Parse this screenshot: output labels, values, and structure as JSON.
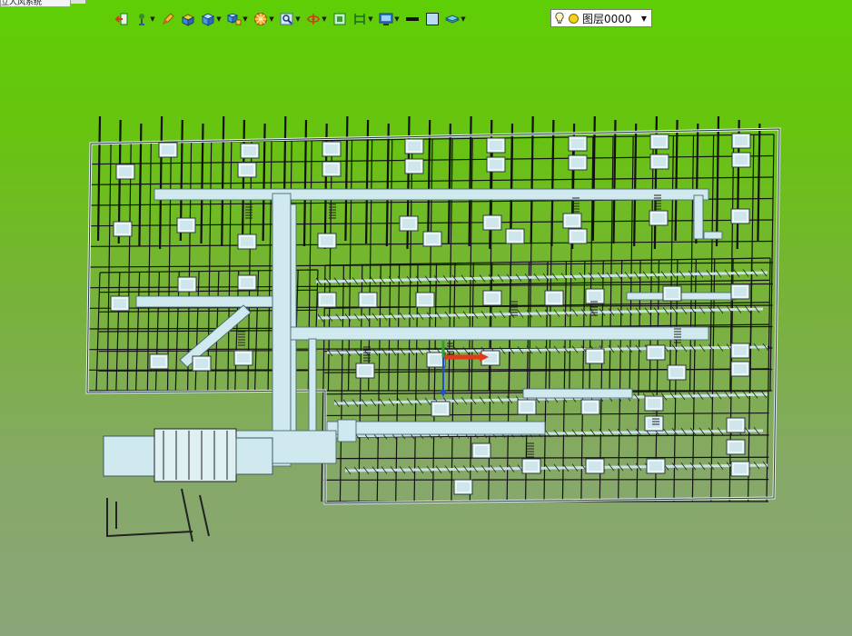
{
  "document_tab": {
    "title": "立人风系统"
  },
  "toolbar": {
    "buttons": [
      {
        "name": "exit-icon",
        "dropdown": false
      },
      {
        "name": "pin-icon",
        "dropdown": true
      },
      {
        "name": "pencil-icon",
        "dropdown": false
      },
      {
        "name": "box-face-icon",
        "dropdown": false
      },
      {
        "name": "cube-icon",
        "dropdown": true
      },
      {
        "name": "cube-view-icon",
        "dropdown": true
      },
      {
        "name": "wheel-icon",
        "dropdown": true
      },
      {
        "name": "zoom-window-icon",
        "dropdown": true
      },
      {
        "name": "orbit-icon",
        "dropdown": true
      },
      {
        "name": "frame-icon",
        "dropdown": false
      },
      {
        "name": "column-icon",
        "dropdown": true
      },
      {
        "name": "monitor-icon",
        "dropdown": true
      },
      {
        "name": "lineweight-icon",
        "dropdown": false
      },
      {
        "name": "color-swatch-icon",
        "dropdown": false
      },
      {
        "name": "layer-stack-icon",
        "dropdown": true
      }
    ]
  },
  "layer_select": {
    "bulb_icon": "bulb-icon",
    "sun_icon": "sun-icon",
    "value": "图层0000"
  },
  "colors": {
    "background_top": "#5fcf05",
    "background_bottom": "#8aa679",
    "duct": "#cfe9ee",
    "wire": "#141414",
    "ucs_x": "#e03a1a",
    "ucs_y": "#2fa02f",
    "ucs_z": "#1e4fd6"
  }
}
